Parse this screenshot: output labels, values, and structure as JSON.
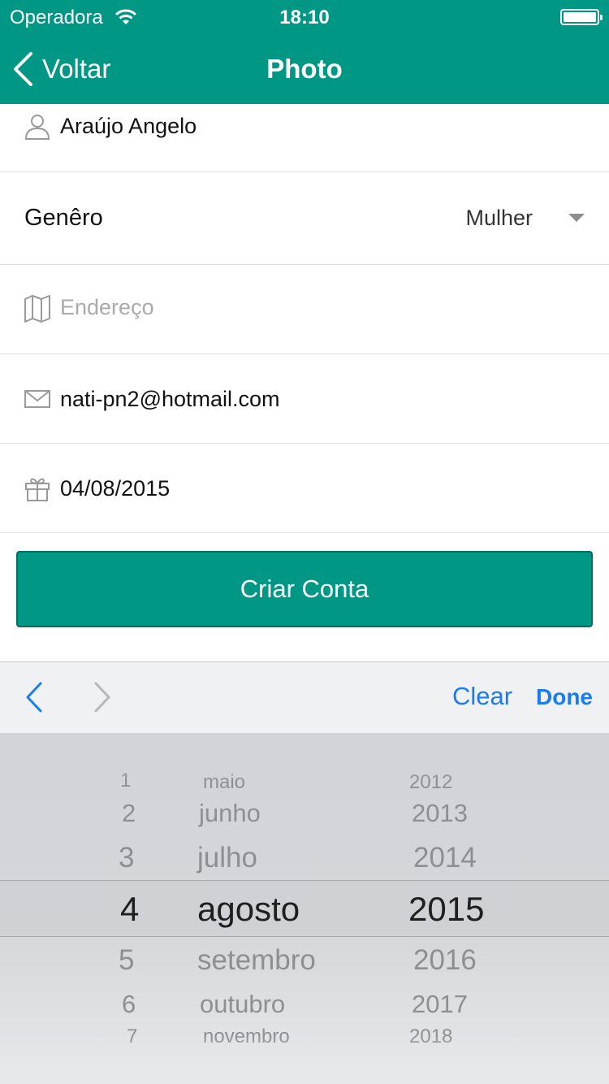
{
  "status_bar": {
    "carrier": "Operadora",
    "time": "18:10"
  },
  "nav": {
    "back_label": "Voltar",
    "title": "Photo"
  },
  "form": {
    "name": {
      "value": "Araújo Angelo",
      "icon": "person-icon"
    },
    "gender": {
      "label": "Genêro",
      "value": "Mulher"
    },
    "address": {
      "placeholder": "Endereço",
      "icon": "map-icon"
    },
    "email": {
      "value": "nati-pn2@hotmail.com",
      "icon": "envelope-icon"
    },
    "birthday": {
      "value": "04/08/2015",
      "icon": "gift-icon"
    },
    "submit_label": "Criar Conta"
  },
  "toolbar": {
    "clear_label": "Clear",
    "done_label": "Done"
  },
  "picker": {
    "days": [
      "1",
      "2",
      "3",
      "4",
      "5",
      "6",
      "7"
    ],
    "months": [
      "maio",
      "junho",
      "julho",
      "agosto",
      "setembro",
      "outubro",
      "novembro"
    ],
    "years": [
      "2012",
      "2013",
      "2014",
      "2015",
      "2016",
      "2017",
      "2018"
    ],
    "selected_index": 3
  },
  "colors": {
    "brand": "#009884",
    "link": "#1a7cf5"
  }
}
